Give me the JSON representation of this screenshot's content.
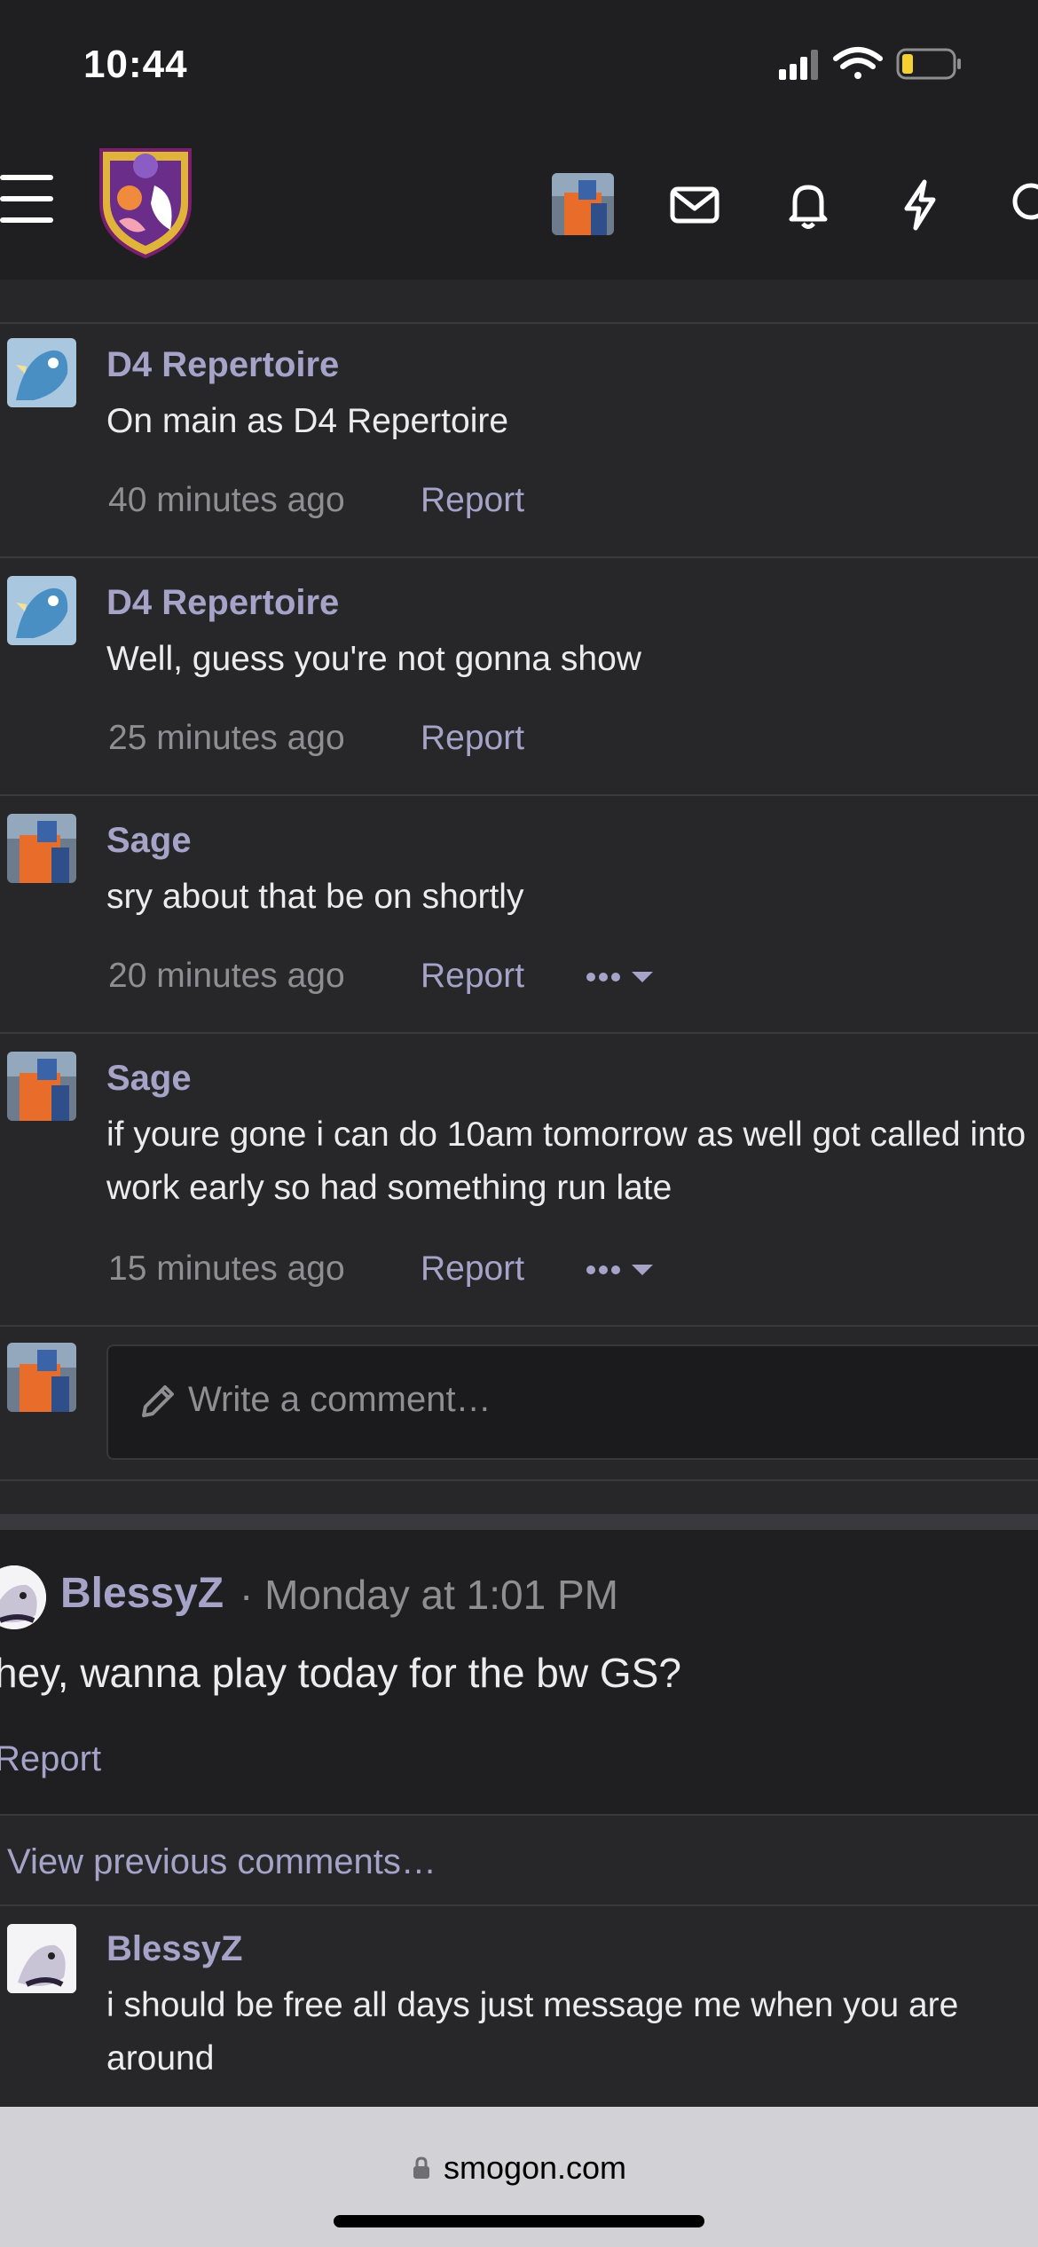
{
  "status_bar": {
    "time": "10:44"
  },
  "nav": {
    "icons": [
      "menu-icon",
      "site-logo",
      "user-avatar",
      "mail-icon",
      "bell-icon",
      "bolt-icon",
      "search-icon"
    ]
  },
  "comments": [
    {
      "author": "D4 Repertoire",
      "text": "On main as D4 Repertoire",
      "time": "40 minutes ago",
      "report": "Report"
    },
    {
      "author": "D4 Repertoire",
      "text": "Well, guess you're not gonna show",
      "time": "25 minutes ago",
      "report": "Report"
    },
    {
      "author": "Sage",
      "text": "sry about that be on shortly",
      "time": "20 minutes ago",
      "report": "Report"
    },
    {
      "author": "Sage",
      "text": "if youre gone i can do 10am tomorrow as well got called into work early so had something run late",
      "time": "15 minutes ago",
      "report": "Report"
    }
  ],
  "compose": {
    "placeholder": "Write a comment…"
  },
  "post": {
    "author": "BlessyZ",
    "meta": "· Monday at 1:01 PM",
    "text": "hey, wanna play today for the bw GS?",
    "report": "Report"
  },
  "view_previous": "View previous comments…",
  "last_comment": {
    "author": "BlessyZ",
    "text": "i should be free all days just message me when you are around"
  },
  "browser": {
    "url": "smogon.com"
  },
  "colors": {
    "background": "#27272a",
    "header": "#1f1f21",
    "link": "#a7a3c8",
    "muted": "#8e8e93",
    "url_bar": "#d1d1d6"
  }
}
